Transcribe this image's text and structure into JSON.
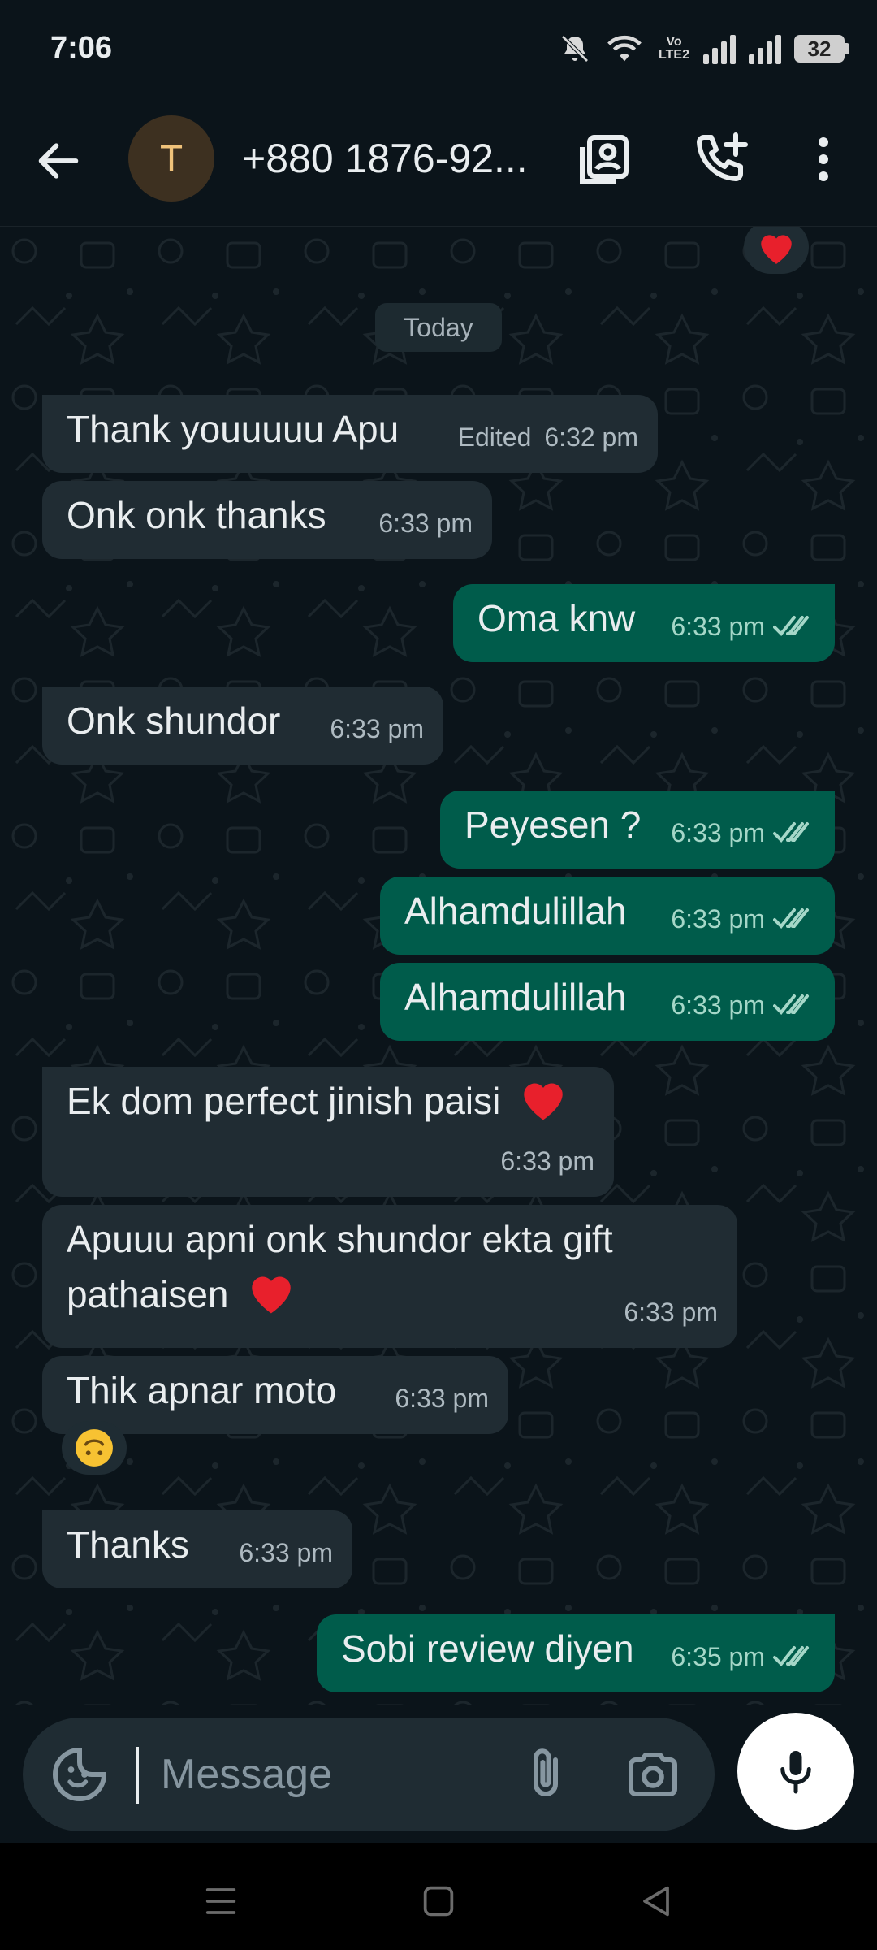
{
  "status_bar": {
    "time": "7:06",
    "volte": "Vo LTE2",
    "battery": "32"
  },
  "header": {
    "avatar_letter": "T",
    "contact": "+880 1876-92..."
  },
  "chat": {
    "date_chip": "Today",
    "messages": [
      {
        "text": "Thank youuuuu Apu",
        "edited": "Edited",
        "time": "6:32 pm"
      },
      {
        "text": "Onk onk thanks",
        "time": "6:33 pm"
      },
      {
        "text": "Oma knw",
        "time": "6:33 pm"
      },
      {
        "text": "Onk shundor",
        "time": "6:33 pm"
      },
      {
        "text": "Peyesen ?",
        "time": "6:33 pm"
      },
      {
        "text": "Alhamdulillah",
        "time": "6:33 pm"
      },
      {
        "text": "Alhamdulillah",
        "time": "6:33 pm"
      },
      {
        "text": "Ek dom perfect jinish paisi",
        "time": "6:33 pm"
      },
      {
        "text": "Apuuu apni onk shundor ekta gift",
        "text2": "pathaisen",
        "time": "6:33 pm"
      },
      {
        "text": "Thik apnar moto",
        "time": "6:33 pm"
      },
      {
        "text": "Thanks",
        "time": "6:33 pm"
      },
      {
        "text": "Sobi review diyen",
        "time": "6:35 pm"
      }
    ]
  },
  "composer": {
    "placeholder": "Message"
  },
  "colors": {
    "background": "#0b141a",
    "incoming": "#202c33",
    "outgoing": "#005c4b",
    "tick": "#a5d7c8"
  }
}
